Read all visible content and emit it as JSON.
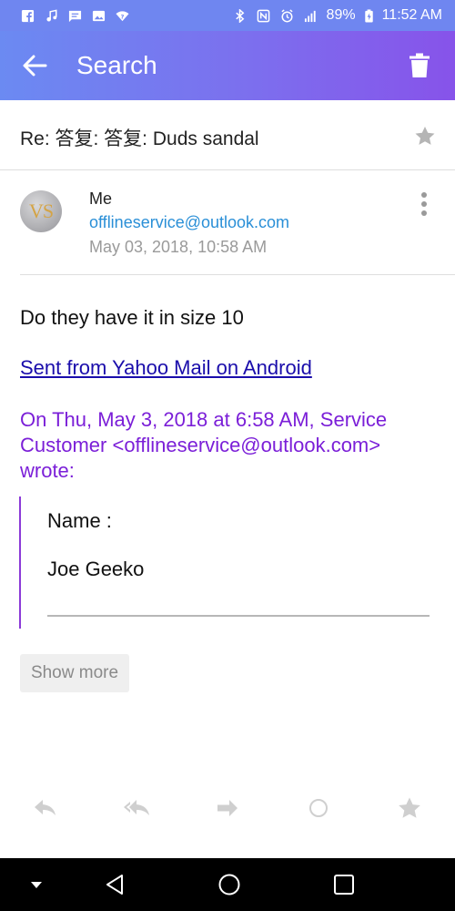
{
  "status_bar": {
    "battery": "89%",
    "time": "11:52 AM",
    "left_icons": [
      "facebook-icon",
      "music-icon",
      "message-icon",
      "gallery-icon",
      "wifi-question-icon"
    ],
    "right_icons": [
      "bluetooth-icon",
      "nfc-icon",
      "alarm-icon",
      "signal-icon",
      "battery-icon"
    ]
  },
  "app_bar": {
    "title": "Search",
    "back_icon": "arrow-left-icon",
    "delete_icon": "trash-icon"
  },
  "email": {
    "subject": "Re: 答复: 答复: Duds sandal",
    "sender": {
      "avatar_initials": "VS",
      "name": "Me",
      "email": "offlineservice@outlook.com",
      "date": "May 03, 2018, 10:58 AM"
    },
    "body": {
      "line1": "Do they have it in size 10",
      "signature_link": "Sent from Yahoo Mail on Android",
      "quote_header": "On Thu, May 3, 2018 at 6:58 AM, Service Customer <offlineservice@outlook.com> wrote:",
      "quote_name_label": "Name :",
      "quote_name_value": "Joe Geeko"
    },
    "show_more": "Show more"
  },
  "actions": [
    "reply-icon",
    "reply-all-icon",
    "forward-icon",
    "unread-icon",
    "star-icon"
  ],
  "colors": {
    "accent_start": "#6b8af2",
    "accent_end": "#8753ea",
    "link_blue": "#2a8fd7",
    "quote_purple": "#7b1fd8",
    "hyperlink": "#1a0dab"
  }
}
